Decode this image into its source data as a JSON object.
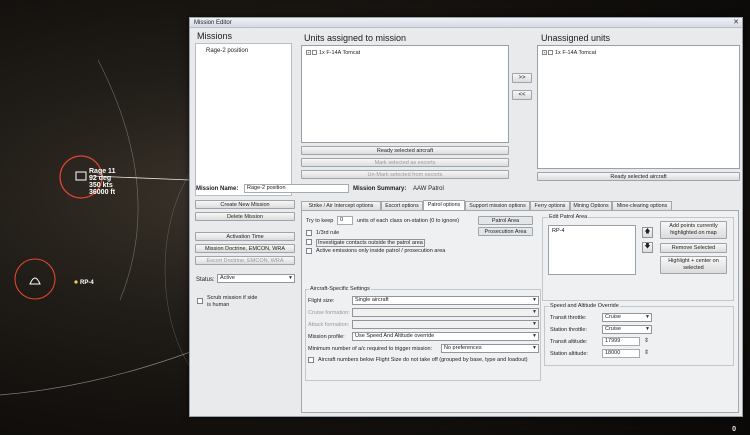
{
  "map": {
    "unit1": {
      "name": "Rage 11",
      "heading": "92 deg",
      "speed": "350 kts",
      "altitude": "36000 ft"
    },
    "unit2": {
      "name": "RP-4"
    },
    "corner_value": "0"
  },
  "window": {
    "title": "Mission Editor",
    "close_glyph": "✕"
  },
  "missions": {
    "header": "Missions",
    "items": [
      "Rage-2 position"
    ]
  },
  "assigned": {
    "header": "Units assigned to mission",
    "items": [
      "1x F-14A Tomcat"
    ],
    "ready_label": "Ready selected aircraft",
    "mark_escorts_label": "Mark selected as escorts",
    "unmark_escorts_label": "Un-Mark selected from escorts"
  },
  "transfer": {
    "right_label": ">>",
    "left_label": "<<"
  },
  "unassigned": {
    "header": "Unassigned units",
    "items": [
      "1x F-14A Tomcat"
    ],
    "ready_label": "Ready selected aircraft"
  },
  "mission_name": {
    "label": "Mission Name:",
    "value": "Rage-2 position"
  },
  "mission_summary": {
    "label": "Mission Summary:",
    "value": "AAW Patrol"
  },
  "left_buttons": {
    "create": "Create New Mission",
    "delete": "Delete Mission",
    "activation": "Activation Time",
    "doctrine": "Mission Doctrine, EMCON, WRA",
    "escort_doctrine": "Escort Doctrine, EMCON, WRA"
  },
  "status": {
    "label": "Status:",
    "value": "Active"
  },
  "scrub": {
    "label_line1": "Scrub mission if side",
    "label_line2": "is human"
  },
  "tabs": [
    "Strike / Air Intercept options",
    "Escort options",
    "Patrol options",
    "Support mission options",
    "Ferry options",
    "Mining Options",
    "Mine-clearing options"
  ],
  "patrol": {
    "try_keep_label": "Try to keep",
    "try_keep_value": "0",
    "try_keep_suffix": "units of each class on-station (0 to ignore)",
    "third_rule": "1/3rd rule",
    "investigate": "Investigate contacts outside the patrol area",
    "active_emissions": "Active emissions only inside patrol / prosecution area",
    "patrol_area_btn": "Patrol Area",
    "prosecution_area_btn": "Prosecution Area"
  },
  "edit_area": {
    "title": "Edit Patrol Area",
    "points": [
      "RP-4"
    ],
    "up_glyph": "🡅",
    "down_glyph": "🡇",
    "add_points": "Add points currently highlighted on map",
    "remove_selected": "Remove Selected",
    "highlight_center": "Highlight + center on selected"
  },
  "aircraft": {
    "title": "Aircraft-Specific Settings",
    "flight_size_label": "Flight size:",
    "flight_size_value": "Single aircraft",
    "cruise_formation_label": "Cruise formation:",
    "attack_formation_label": "Attack formation:",
    "mission_profile_label": "Mission profile:",
    "mission_profile_value": "Use Speed And Altitude override",
    "min_number_label": "Minimum number of a/c required to trigger mission:",
    "min_number_value": "No preferences",
    "below_flight_size": "Aircraft numbers below Flight Size do not take off (grouped by base, type and loadout)"
  },
  "speed_alt": {
    "title": "Speed and Altitude Override",
    "transit_throttle_label": "Transit throttle:",
    "transit_throttle_value": "Cruise",
    "station_throttle_label": "Station throttle:",
    "station_throttle_value": "Cruise",
    "transit_altitude_label": "Transit altitude:",
    "transit_altitude_value": "17999",
    "station_altitude_label": "Station altitude:",
    "station_altitude_value": "18000"
  }
}
